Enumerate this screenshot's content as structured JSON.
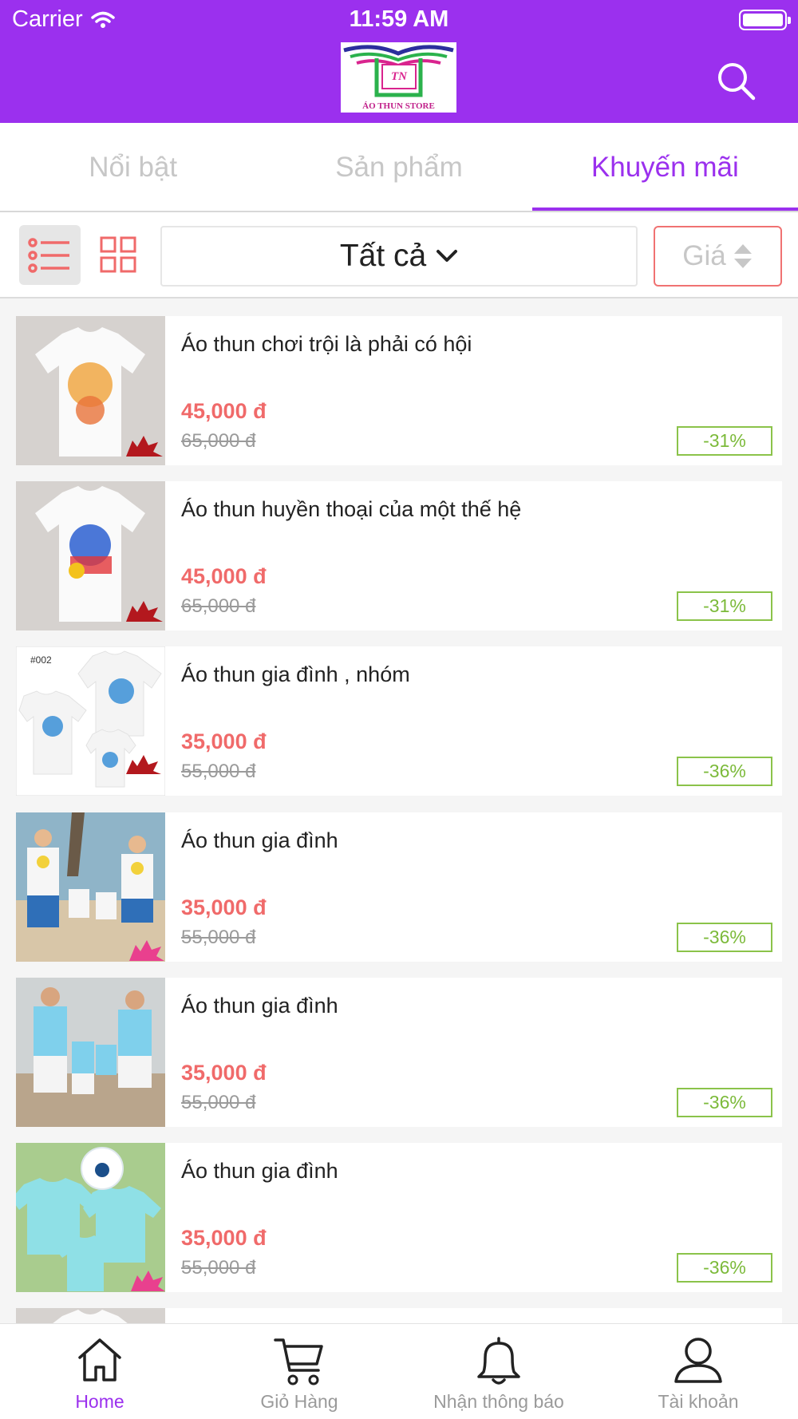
{
  "status_bar": {
    "carrier": "Carrier",
    "time": "11:59 AM"
  },
  "header": {
    "logo_text": "ÁO THUN STORE",
    "logo_initials": "TN",
    "brand_color": "#9b30ee"
  },
  "tabs": [
    {
      "label": "Nổi bật",
      "active": false
    },
    {
      "label": "Sản phẩm",
      "active": false
    },
    {
      "label": "Khuyến mãi",
      "active": true
    }
  ],
  "filter": {
    "category": "Tất cả",
    "sort_label": "Giá"
  },
  "products": [
    {
      "name": "Áo thun chơi trội là phải có hội",
      "price": "45,000 đ",
      "old_price": "65,000 đ",
      "discount": "-31%"
    },
    {
      "name": "Áo thun huyền thoại của một thế hệ",
      "price": "45,000 đ",
      "old_price": "65,000 đ",
      "discount": "-31%"
    },
    {
      "name": "Áo thun gia đình , nhóm",
      "price": "35,000 đ",
      "old_price": "55,000 đ",
      "discount": "-36%",
      "thumb_label": "#002"
    },
    {
      "name": "Áo thun gia đình",
      "price": "35,000 đ",
      "old_price": "55,000 đ",
      "discount": "-36%"
    },
    {
      "name": "Áo thun gia đình",
      "price": "35,000 đ",
      "old_price": "55,000 đ",
      "discount": "-36%"
    },
    {
      "name": "Áo thun gia đình",
      "price": "35,000 đ",
      "old_price": "55,000 đ",
      "discount": "-36%"
    }
  ],
  "bottom_nav": [
    {
      "label": "Home",
      "icon": "home-icon",
      "active": true
    },
    {
      "label": "Giỏ Hàng",
      "icon": "cart-icon",
      "active": false
    },
    {
      "label": "Nhận thông báo",
      "icon": "bell-icon",
      "active": false
    },
    {
      "label": "Tài khoản",
      "icon": "user-icon",
      "active": false
    }
  ],
  "colors": {
    "accent": "#9b30ee",
    "price": "#f06a6a",
    "discount": "#8bc34a",
    "sort_border": "#f07272"
  }
}
